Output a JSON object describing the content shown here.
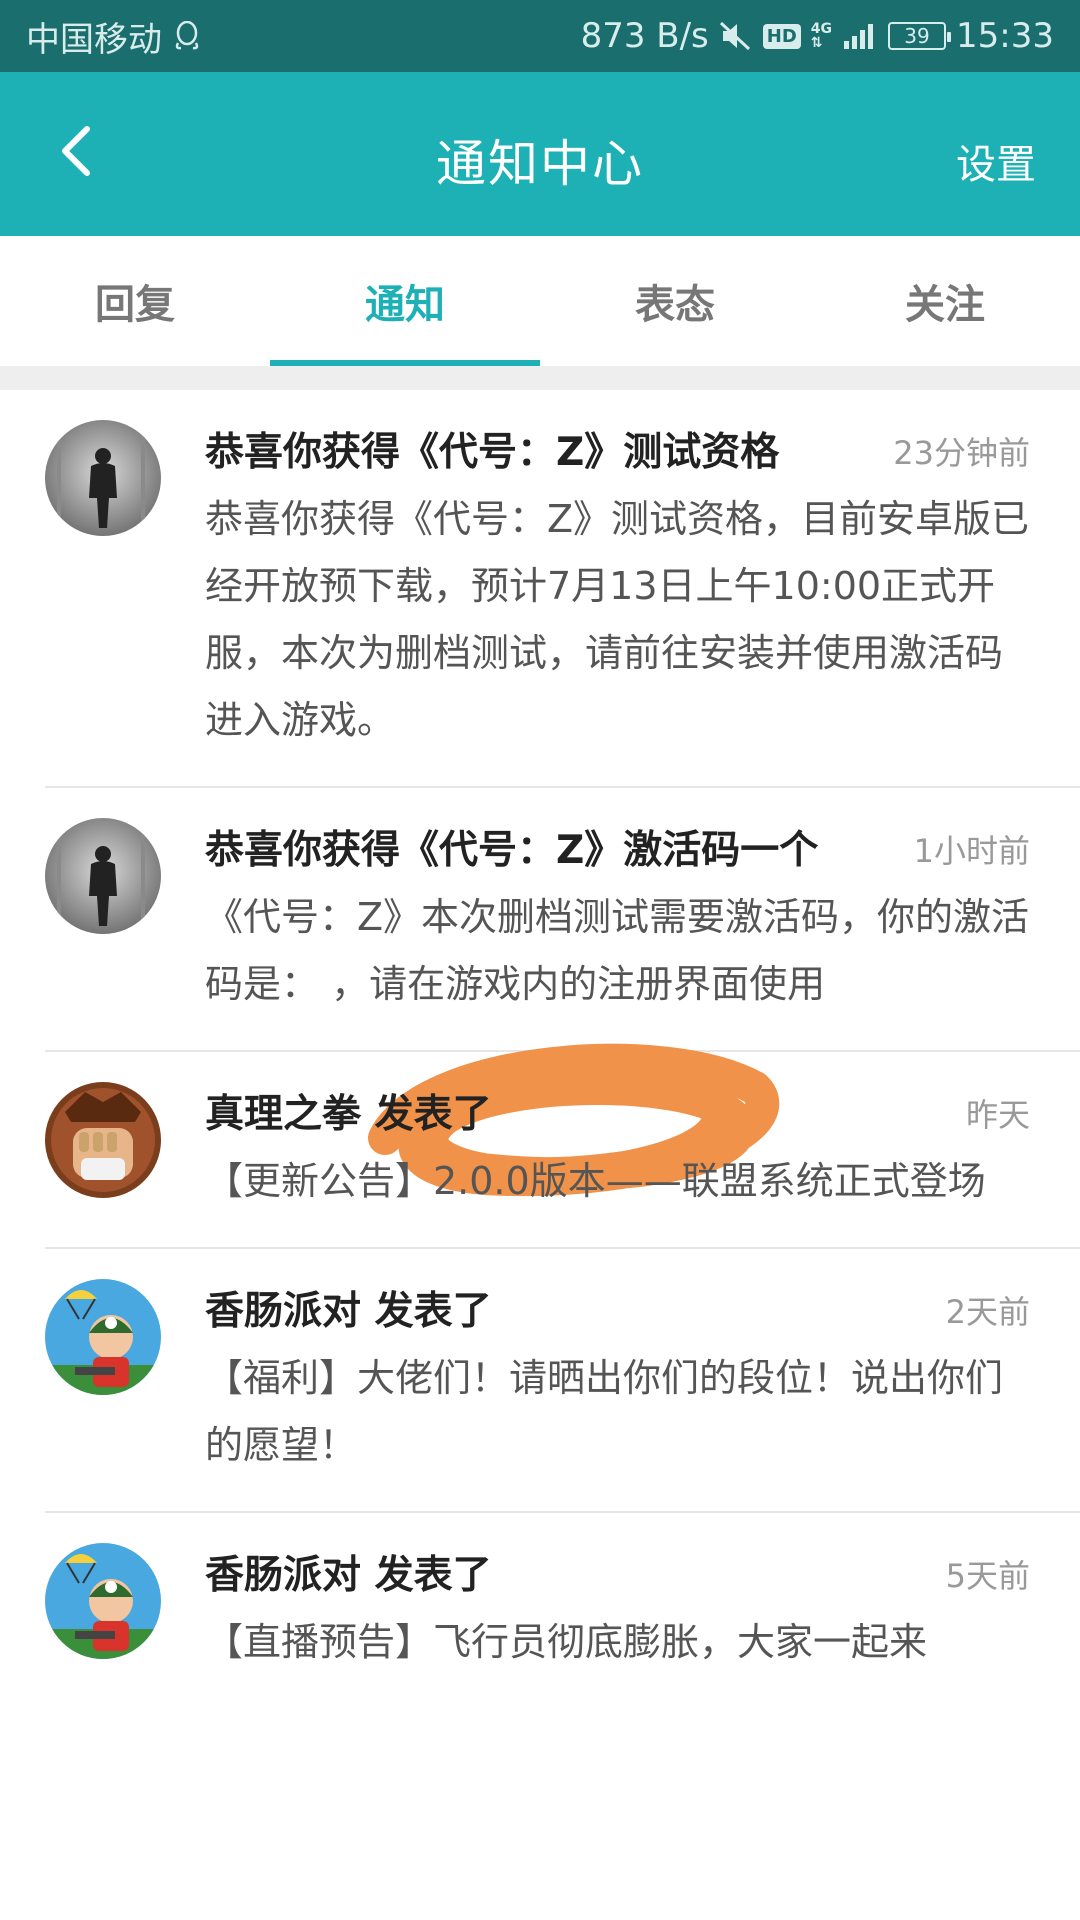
{
  "status_bar": {
    "carrier": "中国移动",
    "speed": "873 B/s",
    "network": "4G",
    "battery": "39",
    "time": "15:33"
  },
  "header": {
    "title": "通知中心",
    "settings_label": "设置"
  },
  "tabs": [
    {
      "label": "回复",
      "active": false
    },
    {
      "label": "通知",
      "active": true
    },
    {
      "label": "表态",
      "active": false
    },
    {
      "label": "关注",
      "active": false
    }
  ],
  "notifications": [
    {
      "title": "恭喜你获得《代号：Z》测试资格",
      "time": "23分钟前",
      "body": "恭喜你获得《代号：Z》测试资格，目前安卓版已经开放预下载，预计7月13日上午10:00正式开服，本次为删档测试，请前往安装并使用激活码进入游戏。",
      "avatar": "walking-man-avatar"
    },
    {
      "title": "恭喜你获得《代号：Z》激活码一个",
      "time": "1小时前",
      "body": "《代号：Z》本次删档测试需要激活码，你的激活码是：     ，请在游戏内的注册界面使用",
      "avatar": "walking-man-avatar"
    },
    {
      "title": "真理之拳 发表了",
      "time": "昨天",
      "body": "【更新公告】2.0.0版本——联盟系统正式登场",
      "avatar": "fist-avatar"
    },
    {
      "title": "香肠派对 发表了",
      "time": "2天前",
      "body": "【福利】大佬们！请晒出你们的段位！说出你们的愿望！",
      "avatar": "parachute-soldier-avatar"
    },
    {
      "title": "香肠派对 发表了",
      "time": "5天前",
      "body": "【直播预告】飞行员彻底膨胀，大家一起来",
      "avatar": "parachute-soldier-avatar"
    }
  ],
  "colors": {
    "status_bar": "#1a6e6e",
    "header": "#1db1b6",
    "accent": "#1db1b6",
    "redaction": "#f0924a"
  }
}
